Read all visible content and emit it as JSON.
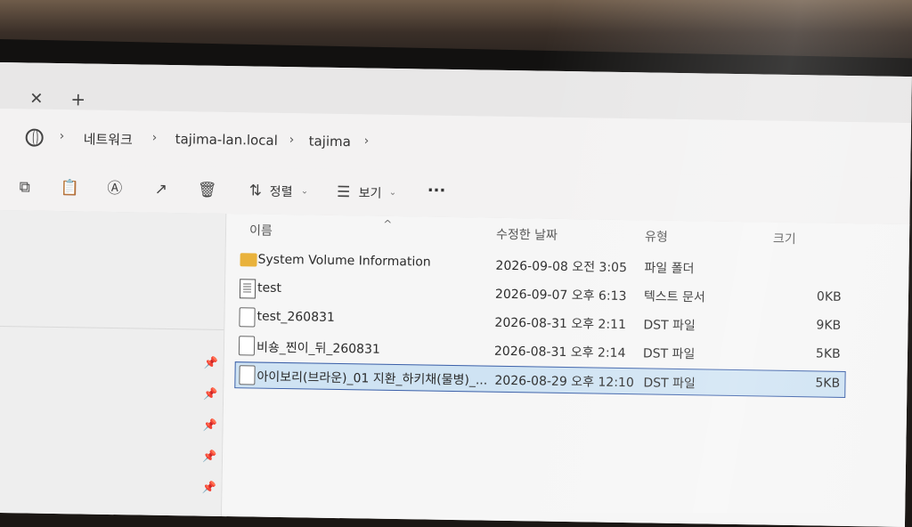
{
  "tabbar": {
    "close": "✕",
    "new_tab": "+"
  },
  "address": {
    "segments": [
      "네트워크",
      "tajima-lan.local",
      "tajima"
    ]
  },
  "toolbar": {
    "sort_label": "정렬",
    "view_label": "보기",
    "more": "···"
  },
  "columns": {
    "name": "이름",
    "date": "수정한 날짜",
    "type": "유형",
    "size": "크기"
  },
  "files": [
    {
      "name": "System Volume Information",
      "date": "2026-09-08 오전 3:05",
      "type": "파일 폴더",
      "size": "",
      "icon": "folder-icon"
    },
    {
      "name": "test",
      "date": "2026-09-07 오후 6:13",
      "type": "텍스트 문서",
      "size": "0KB",
      "icon": "text-file-icon"
    },
    {
      "name": "test_260831",
      "date": "2026-08-31 오후 2:11",
      "type": "DST 파일",
      "size": "9KB",
      "icon": "file-icon"
    },
    {
      "name": "비숑_찐이_뒤_260831",
      "date": "2026-08-31 오후 2:14",
      "type": "DST 파일",
      "size": "5KB",
      "icon": "file-icon"
    },
    {
      "name": "아이보리(브라운)_01 지환_하키채(물병)_...",
      "date": "2026-08-29 오후 12:10",
      "type": "DST 파일",
      "size": "5KB",
      "icon": "file-icon",
      "selected": true
    }
  ]
}
